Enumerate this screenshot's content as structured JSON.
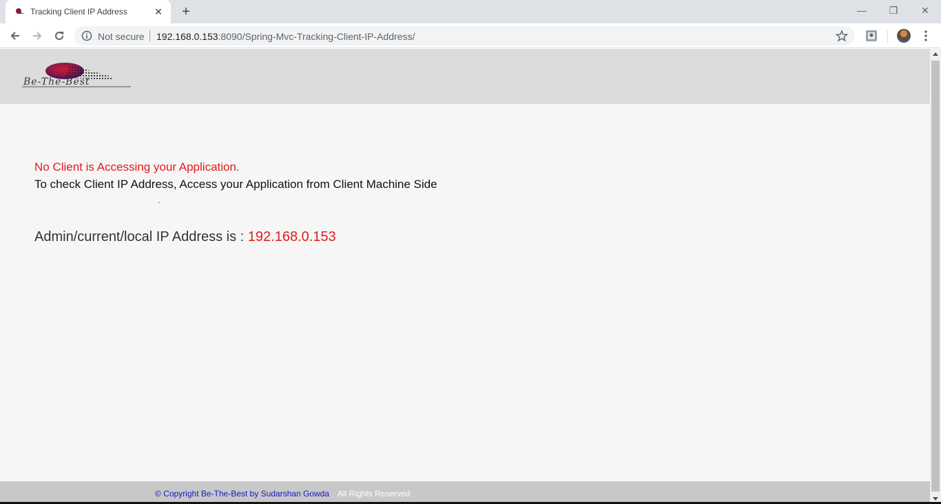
{
  "browser": {
    "tab_title": "Tracking Client IP Address",
    "tab_close": "✕",
    "new_tab": "+",
    "security_label": "Not secure",
    "url_host": "192.168.0.153",
    "url_rest": ":8090/Spring-Mvc-Tracking-Client-IP-Address/",
    "window_minimize": "—",
    "window_restore": "❐",
    "window_close": "✕"
  },
  "site": {
    "logo_text": "Be-The-Best",
    "message_no_client": "No Client is Accessing your Application.",
    "message_instruction": "To check Client IP Address, Access your Application from Client Machine Side",
    "dot": ".",
    "ip_label": "Admin/current/local IP Address is : ",
    "ip_value": "192.168.0.153",
    "footer_copyright": "© Copyright Be-The-Best by Sudarshan Gowda",
    "footer_rights": "All Rights Reserved"
  },
  "colors": {
    "accent_red": "#e31b1b",
    "footer_link": "#1515c8",
    "header_bg": "#dcdcdc",
    "footer_bg": "#c8c8c8"
  },
  "icons": [
    "site-favicon-icon",
    "back-arrow-icon",
    "forward-arrow-icon",
    "reload-icon",
    "info-icon",
    "star-icon",
    "extension-icon",
    "avatar",
    "kebab-menu-icon"
  ]
}
